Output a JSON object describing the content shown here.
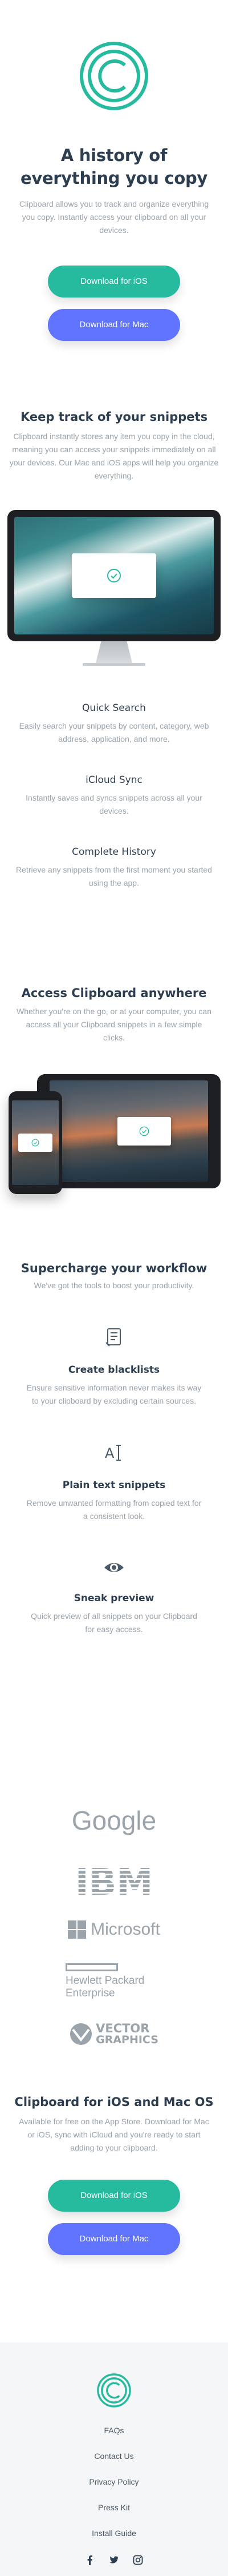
{
  "hero": {
    "title": "A history of everything you copy",
    "description": "Clipboard allows you to track and organize everything you copy. Instantly access your clipboard on all your devices.",
    "ios_button": "Download for iOS",
    "mac_button": "Download for Mac"
  },
  "snippets": {
    "title": "Keep track of your snippets",
    "description": "Clipboard instantly stores any item you copy in the cloud, meaning you can access your snippets immediately on all your devices. Our Mac and iOS apps will help you organize everything.",
    "features": [
      {
        "title": "Quick Search",
        "text": "Easily search your snippets by content, category, web address, application, and more."
      },
      {
        "title": "iCloud Sync",
        "text": "Instantly saves and syncs snippets across all your devices."
      },
      {
        "title": "Complete History",
        "text": "Retrieve any snippets from the first moment you started using the app."
      }
    ]
  },
  "access": {
    "title": "Access Clipboard anywhere",
    "description": "Whether you're on the go, or at your computer, you can access all your Clipboard snippets in a few simple clicks."
  },
  "workflow": {
    "title": "Supercharge your workflow",
    "subtitle": "We've got the tools to boost your productivity.",
    "items": [
      {
        "icon": "blacklist-icon",
        "title": "Create blacklists",
        "text": "Ensure sensitive information never makes its way to your clipboard by excluding certain sources."
      },
      {
        "icon": "text-cursor-icon",
        "title": "Plain text snippets",
        "text": "Remove unwanted formatting from copied text for a consistent look."
      },
      {
        "icon": "eye-icon",
        "title": "Sneak preview",
        "text": "Quick preview of all snippets on your Clipboard for easy access."
      }
    ]
  },
  "partners": {
    "google": "Google",
    "ibm": "IBM",
    "microsoft": "Microsoft",
    "hp_line1": "Hewlett Packard",
    "hp_line2": "Enterprise",
    "vector_line1": "VECTOR",
    "vector_line2": "GRAPHICS"
  },
  "cta": {
    "title": "Clipboard for iOS and Mac OS",
    "description": "Available for free on the App Store. Download for Mac or iOS, sync with iCloud and you're ready to start adding to your clipboard.",
    "ios_button": "Download for iOS",
    "mac_button": "Download for Mac"
  },
  "footer": {
    "links": [
      "FAQs",
      "Contact Us",
      "Privacy Policy",
      "Press Kit",
      "Install Guide"
    ],
    "social": [
      "facebook-icon",
      "twitter-icon",
      "instagram-icon"
    ]
  },
  "colors": {
    "accent_teal": "#26ba9f",
    "accent_blue": "#6174ff",
    "heading": "#2c3e50",
    "body_text": "#9aa3ab",
    "footer_bg": "#f5f6f8"
  }
}
